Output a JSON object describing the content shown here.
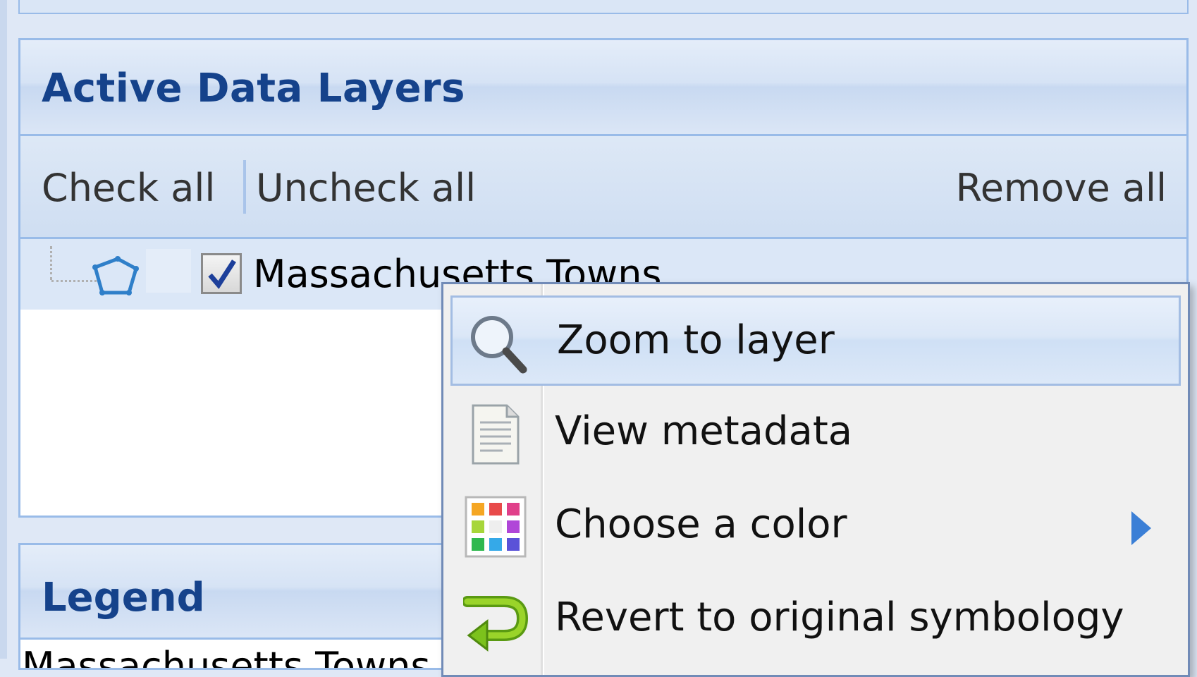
{
  "panel": {
    "title": "Active Data Layers",
    "toolbar": {
      "check_all": "Check all",
      "uncheck_all": "Uncheck all",
      "remove_all": "Remove all"
    },
    "layers": [
      {
        "name": "Massachusetts Towns",
        "checked": true,
        "icon": "polygon-icon"
      }
    ]
  },
  "legend": {
    "title": "Legend",
    "first_entry": "Massachusetts Towns"
  },
  "context_menu": {
    "items": [
      {
        "label": "Zoom to layer",
        "icon": "magnifier-icon",
        "active": true
      },
      {
        "label": "View metadata",
        "icon": "document-icon"
      },
      {
        "label": "Choose a color",
        "icon": "color-palette-icon",
        "has_submenu": true
      },
      {
        "label": "Revert to original symbology",
        "icon": "revert-arrow-icon"
      }
    ]
  },
  "colors": {
    "header_text": "#15428b",
    "border": "#99bbe8",
    "selection": "#dbe7f7"
  }
}
